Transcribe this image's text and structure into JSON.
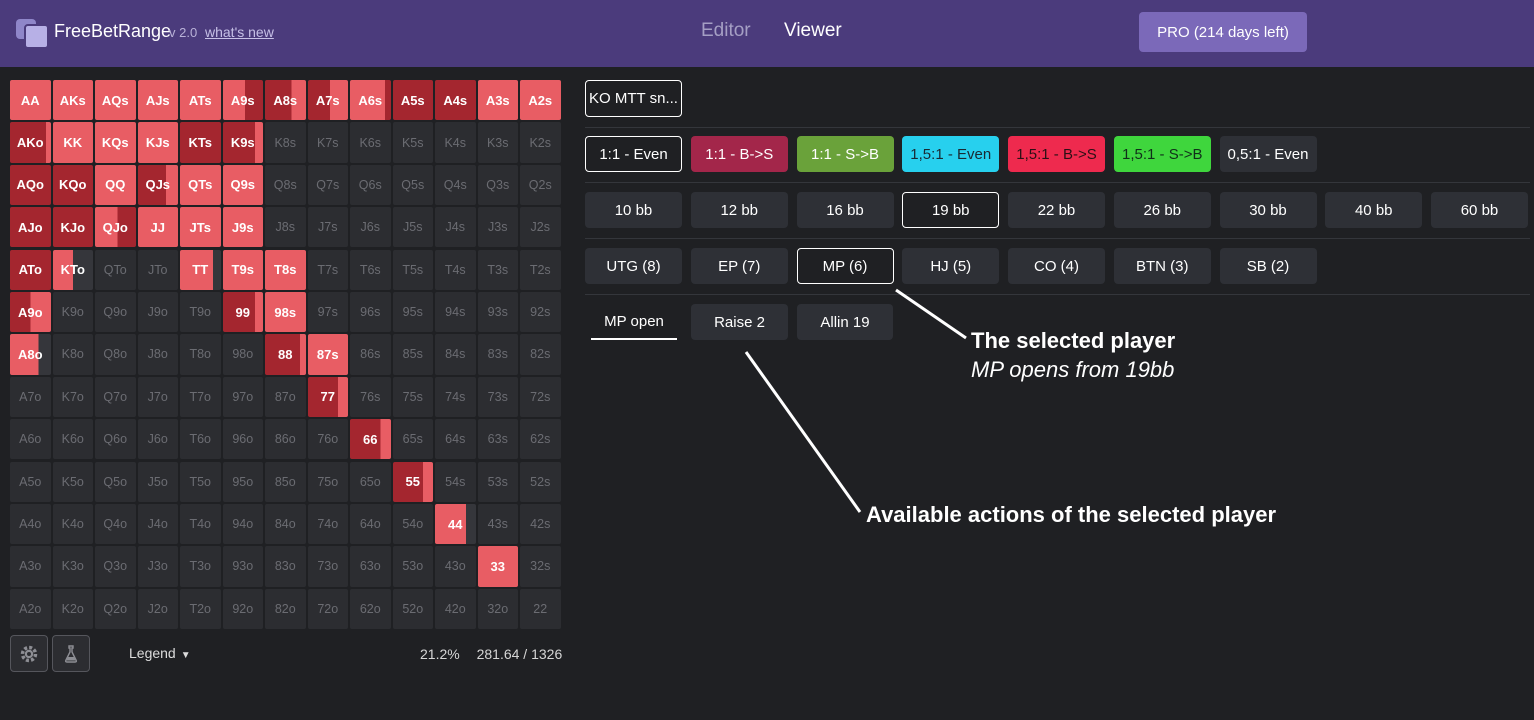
{
  "header": {
    "brand": "FreeBetRange",
    "version": "v 2.0",
    "whats_new": "what's new",
    "nav_editor": "Editor",
    "nav_viewer": "Viewer",
    "pro_label": "PRO (214 days left)"
  },
  "colors": {
    "header_bg": "#4b3b7c",
    "raise": "#e85d64",
    "allin": "#a4262f",
    "fold": "#35363b",
    "cell_empty": "#2c2d31"
  },
  "range_grid": {
    "rows": [
      [
        "AA",
        "AKs",
        "AQs",
        "AJs",
        "ATs",
        "A9s",
        "A8s",
        "A7s",
        "A6s",
        "A5s",
        "A4s",
        "A3s",
        "A2s"
      ],
      [
        "AKo",
        "KK",
        "KQs",
        "KJs",
        "KTs",
        "K9s",
        "K8s",
        "K7s",
        "K6s",
        "K5s",
        "K4s",
        "K3s",
        "K2s"
      ],
      [
        "AQo",
        "KQo",
        "QQ",
        "QJs",
        "QTs",
        "Q9s",
        "Q8s",
        "Q7s",
        "Q6s",
        "Q5s",
        "Q4s",
        "Q3s",
        "Q2s"
      ],
      [
        "AJo",
        "KJo",
        "QJo",
        "JJ",
        "JTs",
        "J9s",
        "J8s",
        "J7s",
        "J6s",
        "J5s",
        "J4s",
        "J3s",
        "J2s"
      ],
      [
        "ATo",
        "KTo",
        "QTo",
        "JTo",
        "TT",
        "T9s",
        "T8s",
        "T7s",
        "T6s",
        "T5s",
        "T4s",
        "T3s",
        "T2s"
      ],
      [
        "A9o",
        "K9o",
        "Q9o",
        "J9o",
        "T9o",
        "99",
        "98s",
        "97s",
        "96s",
        "95s",
        "94s",
        "93s",
        "92s"
      ],
      [
        "A8o",
        "K8o",
        "Q8o",
        "J8o",
        "T8o",
        "98o",
        "88",
        "87s",
        "86s",
        "85s",
        "84s",
        "83s",
        "82s"
      ],
      [
        "A7o",
        "K7o",
        "Q7o",
        "J7o",
        "T7o",
        "97o",
        "87o",
        "77",
        "76s",
        "75s",
        "74s",
        "73s",
        "72s"
      ],
      [
        "A6o",
        "K6o",
        "Q6o",
        "J6o",
        "T6o",
        "96o",
        "86o",
        "76o",
        "66",
        "65s",
        "64s",
        "63s",
        "62s"
      ],
      [
        "A5o",
        "K5o",
        "Q5o",
        "J5o",
        "T5o",
        "95o",
        "85o",
        "75o",
        "65o",
        "55",
        "54s",
        "53s",
        "52s"
      ],
      [
        "A4o",
        "K4o",
        "Q4o",
        "J4o",
        "T4o",
        "94o",
        "84o",
        "74o",
        "64o",
        "54o",
        "44",
        "43s",
        "42s"
      ],
      [
        "A3o",
        "K3o",
        "Q3o",
        "J3o",
        "T3o",
        "93o",
        "83o",
        "73o",
        "63o",
        "53o",
        "43o",
        "33",
        "32s"
      ],
      [
        "A2o",
        "K2o",
        "Q2o",
        "J2o",
        "T2o",
        "92o",
        "82o",
        "72o",
        "62o",
        "52o",
        "42o",
        "32o",
        "22"
      ]
    ],
    "actions": {
      "AA": [
        1,
        0,
        0
      ],
      "AKs": [
        1,
        0,
        0
      ],
      "AQs": [
        1,
        0,
        0
      ],
      "AJs": [
        1,
        0,
        0
      ],
      "ATs": [
        1,
        0,
        0
      ],
      "A9s": [
        0.55,
        0.45,
        0
      ],
      "A8s": [
        0.35,
        0.65,
        0
      ],
      "A7s": [
        0.45,
        0.55,
        0
      ],
      "A6s": [
        0.85,
        0.15,
        0
      ],
      "A5s": [
        0,
        1,
        0
      ],
      "A4s": [
        0,
        1,
        0
      ],
      "A3s": [
        1,
        0,
        0
      ],
      "A2s": [
        1,
        0,
        0
      ],
      "AKo": [
        0.12,
        0.88,
        0
      ],
      "KK": [
        1,
        0,
        0
      ],
      "KQs": [
        1,
        0,
        0
      ],
      "KJs": [
        1,
        0,
        0
      ],
      "KTs": [
        0,
        1,
        0
      ],
      "K9s": [
        0.2,
        0.8,
        0
      ],
      "AQo": [
        0,
        1,
        0
      ],
      "KQo": [
        0,
        1,
        0
      ],
      "QQ": [
        1,
        0,
        0
      ],
      "QJs": [
        0.3,
        0.7,
        0
      ],
      "QTs": [
        1,
        0,
        0
      ],
      "Q9s": [
        1,
        0,
        0
      ],
      "AJo": [
        0,
        1,
        0
      ],
      "KJo": [
        0,
        1,
        0
      ],
      "QJo": [
        0.55,
        0.45,
        0
      ],
      "JJ": [
        1,
        0,
        0
      ],
      "JTs": [
        1,
        0,
        0
      ],
      "J9s": [
        1,
        0,
        0
      ],
      "ATo": [
        0,
        1,
        0
      ],
      "KTo": [
        0.5,
        0,
        0.5
      ],
      "TT": [
        0.8,
        0,
        0.2
      ],
      "T9s": [
        1,
        0,
        0
      ],
      "T8s": [
        1,
        0,
        0
      ],
      "A9o": [
        0.5,
        0.5,
        0
      ],
      "99": [
        0.2,
        0.8,
        0
      ],
      "98s": [
        1,
        0,
        0
      ],
      "A8o": [
        0.7,
        0,
        0.3
      ],
      "88": [
        0.15,
        0.85,
        0
      ],
      "87s": [
        1,
        0,
        0
      ],
      "77": [
        0.25,
        0.75,
        0
      ],
      "66": [
        0.25,
        0.75,
        0
      ],
      "55": [
        0.25,
        0.75,
        0
      ],
      "44": [
        0.75,
        0,
        0.25
      ],
      "33": [
        1,
        0,
        0
      ]
    }
  },
  "footer": {
    "legend_label": "Legend",
    "legend_caret": "▼",
    "percent": "21.2%",
    "combos": "281.64 / 1326"
  },
  "spot": {
    "name": "KO MTT sn..."
  },
  "ratios": [
    {
      "label": "1:1 - Even",
      "bg": "transparent",
      "fg": "#ffffff",
      "selected": true
    },
    {
      "label": "1:1 - B->S",
      "bg": "#a3264a",
      "fg": "#ffffff",
      "selected": false
    },
    {
      "label": "1:1 - S->B",
      "bg": "#6aa23a",
      "fg": "#ffffff",
      "selected": false
    },
    {
      "label": "1,5:1 - Even",
      "bg": "#27d0ee",
      "fg": "#1a2a33",
      "selected": false
    },
    {
      "label": "1,5:1 - B->S",
      "bg": "#ee2a4e",
      "fg": "#2a1015",
      "selected": false
    },
    {
      "label": "1,5:1 - S->B",
      "bg": "#3fd63d",
      "fg": "#10301a",
      "selected": false
    },
    {
      "label": "0,5:1 - Even",
      "bg": "#2e3036",
      "fg": "#ffffff",
      "selected": false
    }
  ],
  "stacks": [
    {
      "label": "10 bb",
      "selected": false
    },
    {
      "label": "12 bb",
      "selected": false
    },
    {
      "label": "16 bb",
      "selected": false
    },
    {
      "label": "19 bb",
      "selected": true
    },
    {
      "label": "22 bb",
      "selected": false
    },
    {
      "label": "26 bb",
      "selected": false
    },
    {
      "label": "30 bb",
      "selected": false
    },
    {
      "label": "40 bb",
      "selected": false
    },
    {
      "label": "60 bb",
      "selected": false
    }
  ],
  "positions": [
    {
      "label": "UTG (8)",
      "selected": false
    },
    {
      "label": "EP (7)",
      "selected": false
    },
    {
      "label": "MP (6)",
      "selected": true
    },
    {
      "label": "HJ (5)",
      "selected": false
    },
    {
      "label": "CO (4)",
      "selected": false
    },
    {
      "label": "BTN (3)",
      "selected": false
    },
    {
      "label": "SB (2)",
      "selected": false
    }
  ],
  "actions_row": {
    "current": "MP open",
    "options": [
      "Raise 2",
      "Allin 19"
    ]
  },
  "annotations": {
    "player_title": "The selected player",
    "player_sub": "MP opens from 19bb",
    "actions_title": "Available actions of the selected player"
  }
}
